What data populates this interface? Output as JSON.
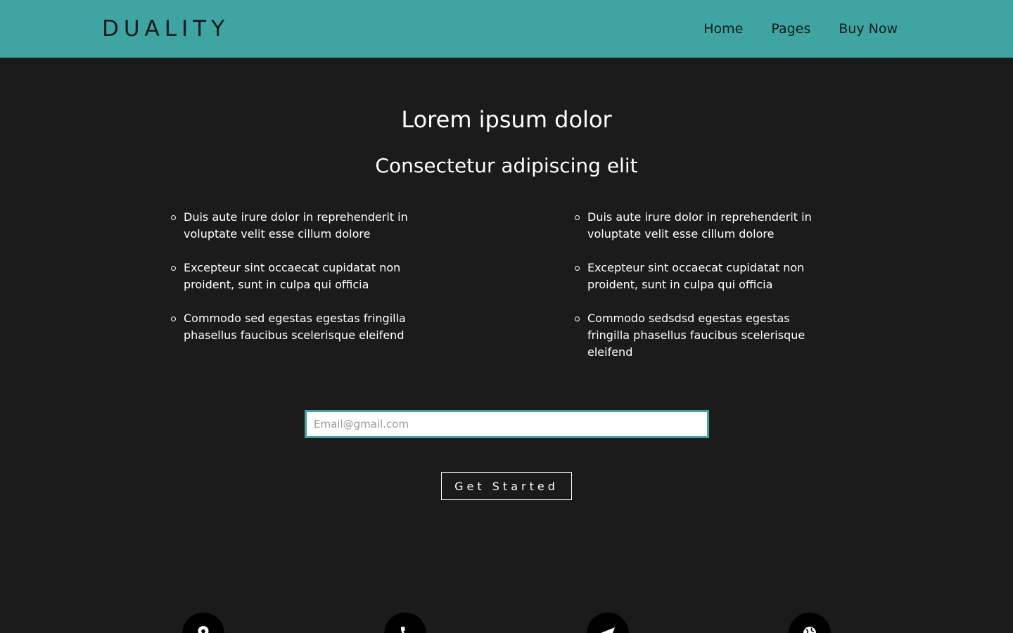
{
  "header": {
    "logo": "DUALITY",
    "nav": [
      "Home",
      "Pages",
      "Buy Now"
    ]
  },
  "hero": {
    "title": "Lorem ipsum dolor",
    "subtitle": "Consectetur adipiscing elit"
  },
  "features": {
    "left": [
      "Duis aute irure dolor in reprehenderit in voluptate velit esse cillum dolore",
      "Excepteur sint occaecat cupidatat non proident, sunt in culpa qui officia",
      "Commodo sed egestas egestas fringilla phasellus faucibus scelerisque eleifend"
    ],
    "right": [
      "Duis aute irure dolor in reprehenderit in voluptate velit esse cillum dolore",
      "Excepteur sint occaecat cupidatat non proident, sunt in culpa qui officia",
      "Commodo sedsdsd egestas egestas fringilla phasellus faucibus scelerisque eleifend"
    ]
  },
  "signup": {
    "email_placeholder": "Email@gmail.com",
    "email_value": "",
    "button_label": "Get Started"
  },
  "contact_icons": [
    "map-pin-icon",
    "phone-icon",
    "paper-plane-icon",
    "globe-icon"
  ],
  "colors": {
    "accent": "#3ea5a2",
    "background": "#1b1b1c",
    "text": "#ffffff"
  }
}
